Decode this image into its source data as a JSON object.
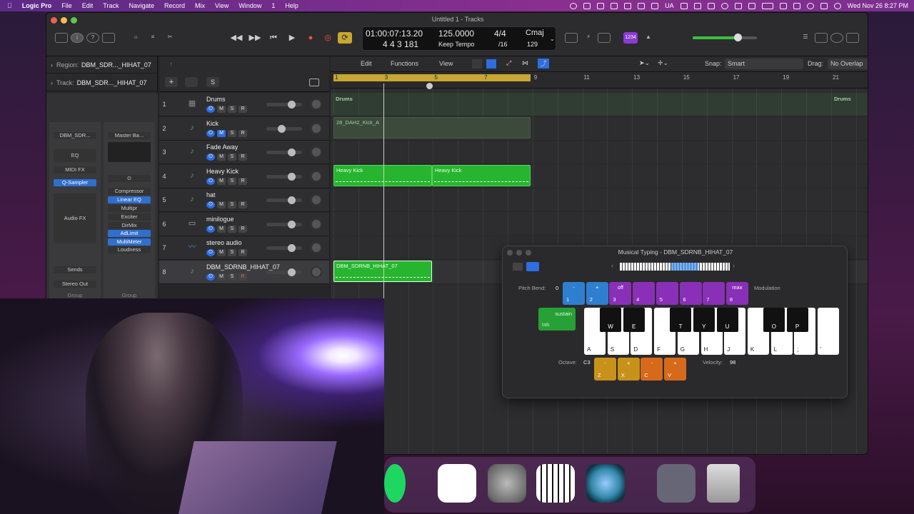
{
  "menubar": {
    "app": "Logic Pro",
    "items": [
      "File",
      "Edit",
      "Track",
      "Navigate",
      "Record",
      "Mix",
      "View",
      "Window",
      "1",
      "Help"
    ],
    "lang": "UA",
    "datetime": "Wed Nov 26  8:27 PM"
  },
  "window": {
    "title": "Untitled 1 - Tracks"
  },
  "lcd": {
    "time": "01:00:07:13.20",
    "bars": "4  4  3  181",
    "tempo": "125.0000",
    "tempo_mode": "Keep Tempo",
    "sig": "4/4",
    "div": "/16",
    "key": "Cmaj",
    "key_num": "129"
  },
  "toolbar": {
    "count_in": "1234"
  },
  "inspector": {
    "region_label": "Region:",
    "region_name": "DBM_SDR..._HIHAT_07",
    "track_label": "Track:",
    "track_name": "DBM_SDR..._HIHAT_07",
    "strip1": {
      "name": "DBM_SDR...",
      "eq": "EQ",
      "midi_fx": "MIDI FX",
      "instrument": "Q-Sampler",
      "audio_fx": "Audio FX",
      "sends": "Sends",
      "output": "Stereo Out",
      "group": "Group"
    },
    "strip2": {
      "name": "Master Ba...",
      "plugins": [
        "Compressor",
        "Linear EQ",
        "Multipr",
        "Exciter",
        "DirMix",
        "AdLimit",
        "MultiMeter",
        "Loudness"
      ],
      "group": "Group"
    }
  },
  "tracklist_header": {
    "add": "+",
    "s": "S"
  },
  "tracks": [
    {
      "num": "1",
      "name": "Drums",
      "color": "#888888",
      "r": "R"
    },
    {
      "num": "2",
      "name": "Kick",
      "color": "#2ac03a",
      "r": "R"
    },
    {
      "num": "3",
      "name": "Fade Away",
      "color": "#2ac03a",
      "r": "R"
    },
    {
      "num": "4",
      "name": "Heavy Kick",
      "color": "#2ac03a",
      "r": "R"
    },
    {
      "num": "5",
      "name": "hat",
      "color": "#2ac03a",
      "r": "R"
    },
    {
      "num": "6",
      "name": "minilogue",
      "color": "#aaaaaa",
      "r": "R"
    },
    {
      "num": "7",
      "name": "stereo audio",
      "color": "#4a8ae0",
      "r": "R"
    },
    {
      "num": "8",
      "name": "DBM_SDRNB_HIHAT_07",
      "color": "#2ac03a",
      "r": "R"
    }
  ],
  "arrange_header": {
    "edit": "Edit",
    "functions": "Functions",
    "view": "View",
    "snap_label": "Snap:",
    "snap": "Smart",
    "drag_label": "Drag:",
    "drag": "No Overlap"
  },
  "ruler": [
    "1",
    "3",
    "5",
    "7",
    "9",
    "11",
    "13",
    "15",
    "17",
    "19",
    "21"
  ],
  "regions": {
    "drums_left": "Drums",
    "drums_right": "Drums",
    "kick": "28_DAH2_Kick_A",
    "heavy1": "Heavy Kick",
    "heavy2": "Heavy Kick",
    "hihat": "DBM_SDRNB_HIHAT_07"
  },
  "musical_typing": {
    "title": "Musical Typing - DBM_SDRNB_HIHAT_07",
    "pitch_bend_label": "Pitch Bend:",
    "pitch_bend": "0",
    "modulation": "Modulation",
    "off": "off",
    "max": "max",
    "sustain": "sustain",
    "tab": "tab",
    "octave_label": "Octave:",
    "octave": "C3",
    "velocity_label": "Velocity:",
    "velocity": "98",
    "num_keys": [
      "1",
      "2",
      "3",
      "4",
      "5",
      "6",
      "7",
      "8"
    ],
    "num_tops": [
      "-",
      "+",
      "off",
      "",
      "",
      "",
      "",
      "max"
    ],
    "white_keys": [
      "A",
      "S",
      "D",
      "F",
      "G",
      "H",
      "J",
      "K",
      "L",
      ";",
      "'"
    ],
    "black_keys": [
      "W",
      "E",
      "T",
      "Y",
      "U",
      "O",
      "P"
    ],
    "oct_keys": [
      {
        "top": "-",
        "key": "Z"
      },
      {
        "top": "+",
        "key": "X"
      },
      {
        "top": "-",
        "key": "C"
      },
      {
        "top": "+",
        "key": "V"
      }
    ]
  }
}
